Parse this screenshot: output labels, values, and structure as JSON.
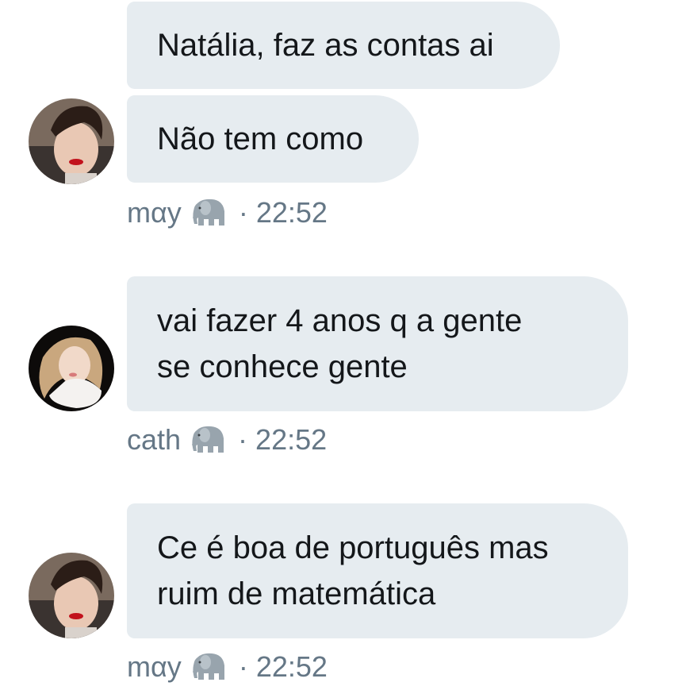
{
  "messages": [
    {
      "lines": [
        "Natália, faz as contas ai"
      ]
    },
    {
      "lines": [
        "Não tem como"
      ]
    },
    {
      "lines": [
        "vai fazer 4 anos q a gente",
        "se conhece gente"
      ]
    },
    {
      "lines": [
        "Ce é boa de português mas",
        "ruim de matemática"
      ]
    }
  ],
  "meta": [
    {
      "sender": "mαy",
      "emoji": "elephant-icon",
      "separator": "·",
      "time": "22:52"
    },
    {
      "sender": "cath",
      "emoji": "elephant-icon",
      "separator": "·",
      "time": "22:52"
    },
    {
      "sender": "mαy",
      "emoji": "elephant-icon",
      "separator": "·",
      "time": "22:52"
    }
  ],
  "colors": {
    "bubble": "#e6ecf0",
    "text": "#14171a",
    "meta": "#657786"
  }
}
